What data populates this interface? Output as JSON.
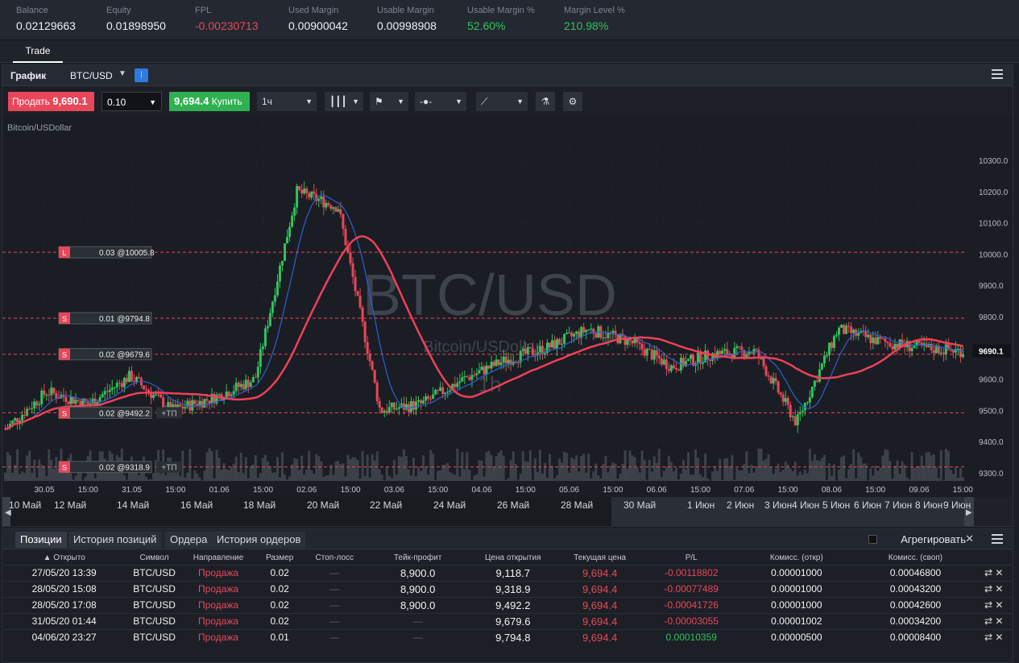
{
  "stats": [
    {
      "label": "Balance",
      "value": "0.02129663",
      "color": "#eef0f3"
    },
    {
      "label": "Equity",
      "value": "0.01898950",
      "color": "#eef0f3"
    },
    {
      "label": "FPL",
      "value": "-0.00230713",
      "color": "#e8475a"
    },
    {
      "label": "Used Margin",
      "value": "0.00900042",
      "color": "#eef0f3"
    },
    {
      "label": "Usable Margin",
      "value": "0.00998908",
      "color": "#eef0f3"
    },
    {
      "label": "Usable Margin %",
      "value": "52.60%",
      "color": "#2fc35c"
    },
    {
      "label": "Margin Level %",
      "value": "210.98%",
      "color": "#2fc35c"
    }
  ],
  "tabs": {
    "trade": "Trade"
  },
  "chart_header": {
    "title": "График",
    "symbol": "BTC/USD"
  },
  "toolbar": {
    "sell_label": "Продать",
    "sell_price": "9,690.1",
    "quantity": "0.10",
    "buy_price": "9,694.4",
    "buy_label": "Купить",
    "timeframe": "1ч"
  },
  "chart": {
    "instrument_label": "Bitcoin/USDollar",
    "watermark_symbol": "BTC/USD",
    "watermark_name": "Bitcoin/USDollar",
    "watermark_tf": "1h",
    "current_price_label": "9690.1",
    "y_ticks": [
      "10300.0",
      "10200.0",
      "10100.0",
      "10000.0",
      "9900.0",
      "9800.0",
      "9700.0",
      "9600.0",
      "9500.0",
      "9400.0",
      "9300.0"
    ],
    "x_ticks": [
      "30.05",
      "15:00",
      "31.05",
      "15:00",
      "01.06",
      "15:00",
      "02.06",
      "15:00",
      "03.06",
      "15:00",
      "04.06",
      "15:00",
      "05.06",
      "15:00",
      "06.06",
      "15:00",
      "07.06",
      "15:00",
      "08.06",
      "15:00",
      "09.06",
      "15:00"
    ],
    "nav_ticks": [
      "10 Май",
      "12 Май",
      "14 Май",
      "16 Май",
      "18 Май",
      "20 Май",
      "22 Май",
      "24 Май",
      "26 Май",
      "28 Май",
      "30 Май",
      "1 Июн",
      "2 Июн",
      "3 Июн",
      "4 Июн",
      "5 Июн",
      "6 Июн",
      "7 Июн",
      "8 Июн",
      "9 Июн"
    ],
    "order_lines": [
      {
        "icon": "L",
        "label": "0.03 @10005.8",
        "tp": ""
      },
      {
        "icon": "S",
        "label": "0.01 @9794.8",
        "tp": ""
      },
      {
        "icon": "S",
        "label": "0.02 @9679.6",
        "tp": ""
      },
      {
        "icon": "S",
        "label": "0.02 @9492.2",
        "tp": "+ТП"
      },
      {
        "icon": "S",
        "label": "0.02 @9318.9",
        "tp": "+ТП"
      }
    ],
    "colors": {
      "up": "#2fc35c",
      "down": "#e8475a",
      "ma_fast": "#2d5fd6",
      "ma_slow": "#f0405a"
    }
  },
  "chart_data": {
    "type": "candlestick",
    "instrument": "BTC/USD",
    "timeframe": "1h",
    "ylim": [
      9250,
      10350
    ],
    "key_points": [
      {
        "x": "29.05",
        "close": 9440
      },
      {
        "x": "30.05 15:00",
        "close": 9560
      },
      {
        "x": "31.05",
        "close": 9520
      },
      {
        "x": "31.05 15:00",
        "close": 9610
      },
      {
        "x": "01.06",
        "close": 9500
      },
      {
        "x": "01.06 15:00",
        "close": 9540
      },
      {
        "x": "02.06",
        "close": 9600
      },
      {
        "x": "02.06 06:00",
        "close": 10200
      },
      {
        "x": "02.06 15:00",
        "close": 10150
      },
      {
        "x": "02.06 17:00",
        "close": 9500
      },
      {
        "x": "03.06",
        "close": 9520
      },
      {
        "x": "03.06 15:00",
        "close": 9600
      },
      {
        "x": "04.06",
        "close": 9660
      },
      {
        "x": "04.06 15:00",
        "close": 9700
      },
      {
        "x": "05.06",
        "close": 9760
      },
      {
        "x": "05.06 15:00",
        "close": 9720
      },
      {
        "x": "06.06",
        "close": 9640
      },
      {
        "x": "06.06 15:00",
        "close": 9680
      },
      {
        "x": "07.06",
        "close": 9690
      },
      {
        "x": "07.06 15:00",
        "close": 9460
      },
      {
        "x": "08.06",
        "close": 9760
      },
      {
        "x": "08.06 15:00",
        "close": 9720
      },
      {
        "x": "09.06",
        "close": 9700
      },
      {
        "x": "09.06 15:00",
        "close": 9690
      }
    ],
    "order_levels": [
      10005.8,
      9794.8,
      9679.6,
      9492.2,
      9318.9
    ],
    "current_price": 9690.1
  },
  "bottom": {
    "tabs": [
      "Позиции",
      "История позиций",
      "Ордера",
      "История ордеров"
    ],
    "aggregate_label": "Агрегировать",
    "columns": [
      "Открыто",
      "Символ",
      "Направление",
      "Размер",
      "Стоп-лосс",
      "Тейк-профит",
      "Цена открытия",
      "Текущая цена",
      "P/L",
      "Комисс. (откр)",
      "Комисс. (своп)"
    ],
    "rows": [
      {
        "opened": "27/05/20 13:39",
        "symbol": "BTC/USD",
        "dir": "Продажа",
        "size": "0.02",
        "sl": "—",
        "tp": "8,900.0",
        "open": "9,118.7",
        "cur": "9,694.4",
        "pl": "-0.00118802",
        "pl_pos": false,
        "com_o": "0.00001000",
        "com_s": "0.00046800"
      },
      {
        "opened": "28/05/20 15:08",
        "symbol": "BTC/USD",
        "dir": "Продажа",
        "size": "0.02",
        "sl": "—",
        "tp": "8,900.0",
        "open": "9,318.9",
        "cur": "9,694.4",
        "pl": "-0.00077489",
        "pl_pos": false,
        "com_o": "0.00001000",
        "com_s": "0.00043200"
      },
      {
        "opened": "28/05/20 17:08",
        "symbol": "BTC/USD",
        "dir": "Продажа",
        "size": "0.02",
        "sl": "—",
        "tp": "8,900.0",
        "open": "9,492.2",
        "cur": "9,694.4",
        "pl": "-0.00041726",
        "pl_pos": false,
        "com_o": "0.00001000",
        "com_s": "0.00042600"
      },
      {
        "opened": "31/05/20 01:44",
        "symbol": "BTC/USD",
        "dir": "Продажа",
        "size": "0.02",
        "sl": "—",
        "tp": "—",
        "open": "9,679.6",
        "cur": "9,694.4",
        "pl": "-0.00003055",
        "pl_pos": false,
        "com_o": "0.00001002",
        "com_s": "0.00034200"
      },
      {
        "opened": "04/06/20 23:27",
        "symbol": "BTC/USD",
        "dir": "Продажа",
        "size": "0.01",
        "sl": "—",
        "tp": "—",
        "open": "9,794.8",
        "cur": "9,694.4",
        "pl": "0.00010359",
        "pl_pos": true,
        "com_o": "0.00000500",
        "com_s": "0.00008400"
      }
    ]
  }
}
